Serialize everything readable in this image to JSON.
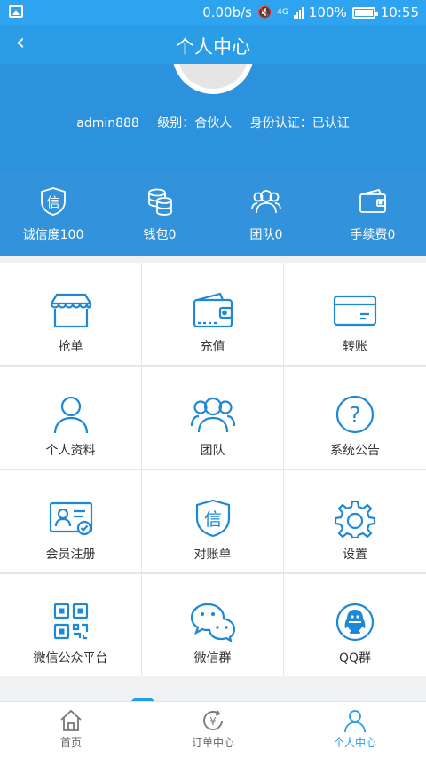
{
  "status_bar": {
    "speed": "0.00b/s",
    "network": "4G",
    "battery": "100%",
    "time": "10:55"
  },
  "header": {
    "title": "个人中心",
    "back_icon": "chevron-left-icon"
  },
  "profile": {
    "username": "admin888",
    "level": "级别：合伙人",
    "verification": "身份认证：已认证"
  },
  "stats": [
    {
      "label": "诚信度100",
      "icon": "credit-shield-icon"
    },
    {
      "label": "钱包0",
      "icon": "coins-icon"
    },
    {
      "label": "团队0",
      "icon": "team-icon"
    },
    {
      "label": "手续费0",
      "icon": "wallet-icon"
    }
  ],
  "menu": [
    {
      "label": "抢单",
      "icon": "shop-icon"
    },
    {
      "label": "充值",
      "icon": "wallet-icon"
    },
    {
      "label": "转账",
      "icon": "card-icon"
    },
    {
      "label": "个人资料",
      "icon": "user-icon"
    },
    {
      "label": "团队",
      "icon": "team-icon"
    },
    {
      "label": "系统公告",
      "icon": "question-icon"
    },
    {
      "label": "会员注册",
      "icon": "id-card-icon"
    },
    {
      "label": "对账单",
      "icon": "credit-shield-icon"
    },
    {
      "label": "设置",
      "icon": "gear-icon"
    },
    {
      "label": "微信公众平台",
      "icon": "qr-code-icon"
    },
    {
      "label": "微信群",
      "icon": "wechat-icon"
    },
    {
      "label": "QQ群",
      "icon": "qq-icon"
    }
  ],
  "tabs": [
    {
      "label": "首页",
      "icon": "home-icon"
    },
    {
      "label": "订单中心",
      "icon": "yuan-order-icon"
    },
    {
      "label": "个人中心",
      "icon": "user-icon"
    }
  ],
  "colors": {
    "primary": "#2b9de6",
    "profile_bg": "#2c92de",
    "stats_bg": "#3392dc",
    "icon": "#1e88d8"
  }
}
